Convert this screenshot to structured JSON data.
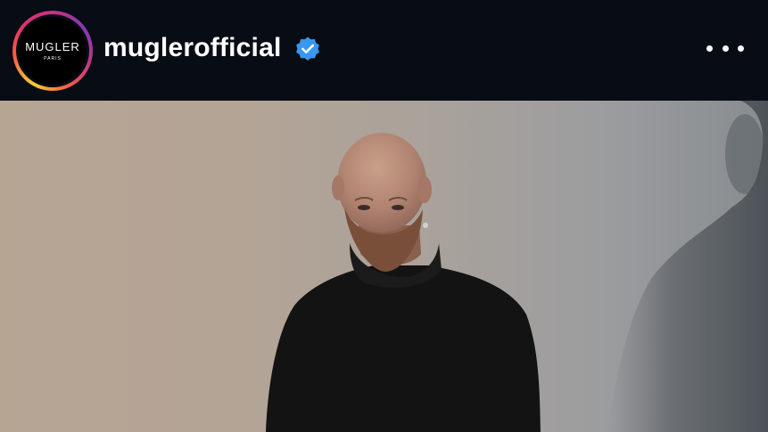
{
  "post_header": {
    "avatar": {
      "brand": "MUGLER",
      "sub": "PARIS"
    },
    "username": "muglerofficial",
    "verified_icon": "verified-badge-icon",
    "more_icon": "more-options-icon"
  },
  "colors": {
    "header_bg": "#080c15",
    "verified_blue": "#3897f0",
    "text": "#ffffff"
  },
  "post_image": {
    "subject": "post-photo"
  }
}
